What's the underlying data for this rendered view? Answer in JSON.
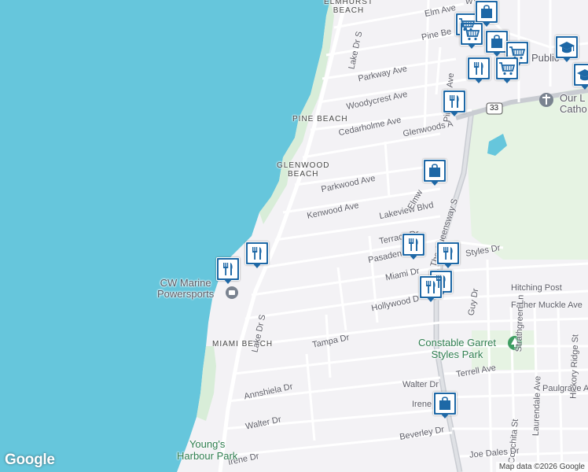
{
  "map": {
    "water_color": "#66c6dc",
    "land_color": "#f3f2f5",
    "park_color": "#e6f3e3",
    "road_color": "#ffffff",
    "highway_color": "#c9ccd2",
    "pin_color": "#1e68a6"
  },
  "labels": {
    "elmhurst_beach": "ELMHURST\nBEACH",
    "pine_beach": "PINE BEACH",
    "glenwood_beach": "GLENWOOD\nBEACH",
    "miami_beach": "MIAMI BEACH",
    "elm_ave": "Elm Ave",
    "pine_beach_rd": "Pine Be",
    "parkway_ave": "Parkway Ave",
    "woodycrest_ave": "Woodycrest Ave",
    "cedarholme_ave": "Cedarholme Ave",
    "glenwoods_ave": "Glenwoods A",
    "parkwood_ave": "Parkwood Ave",
    "kenwood_ave": "Kenwood Ave",
    "lakeview_blvd": "Lakeview Blvd",
    "elmwood": "Elmw",
    "queensway": "The Queensway S",
    "pineway_ave": "Pineway Ave",
    "lake_dr_s_top": "Lake Dr S",
    "lake_dr_s_bottom": "Lake Dr S",
    "terrace_dr": "Terrace Dr",
    "pasadena": "Pasadena",
    "styles_dr": "Styles Dr",
    "miami_dr": "Miami Dr",
    "guy_dr": "Guy Dr",
    "hitching_post": "Hitching Post",
    "father_muckle": "Father Muckle Ave",
    "hollywood_dr": "Hollywood D",
    "strathgreen": "Strathgreen Ln",
    "hickory_ridge": "Hickory Ridge St",
    "tampa_dr": "Tampa Dr",
    "laurendale": "Laurendale Ave",
    "terrell_ave": "Terrell Ave",
    "paulgrave_ave": "Paulgrave Ave",
    "annshiela_dr": "Annshiela Dr",
    "walter_dr_e": "Walter Dr",
    "walter_dr_w": "Walter Dr",
    "irene_dr_e": "Irene",
    "irene_dr_w": "Irene Dr",
    "conchita_st": "Conchita St",
    "beverley_dr": "Beverley Dr",
    "joe_dales_dr": "Joe Dales Dr",
    "public": "Public",
    "our_lady": "Our L\nCatho",
    "route_33": "33",
    "wyi": "WYI"
  },
  "pois": {
    "cw_marine": "CW Marine\nPowersports",
    "constable_park": "Constable Garret\nStyles Park",
    "youngs_harbour": "Young's\nHarbour Park"
  },
  "markers": [
    {
      "type": "restaurant-icon"
    },
    {
      "type": "shopping-cart-icon"
    },
    {
      "type": "shopping-bag-icon"
    },
    {
      "type": "school-icon"
    }
  ],
  "footer": {
    "google": "Google",
    "attribution": "Map data ©2026 Google"
  }
}
